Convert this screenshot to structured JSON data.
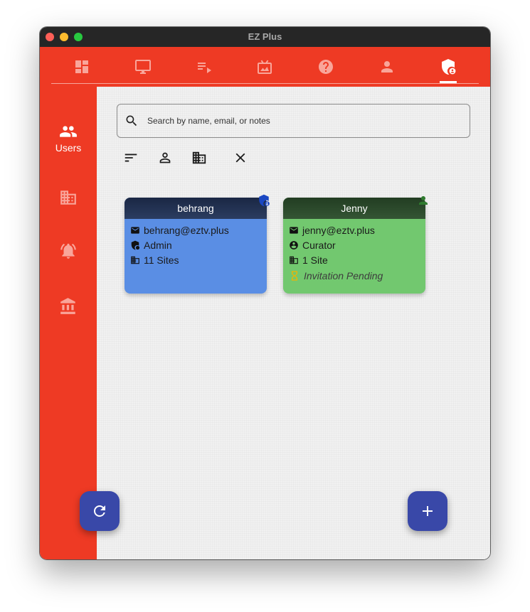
{
  "window": {
    "title": "EZ Plus"
  },
  "top_nav": {
    "tabs": [
      {
        "icon": "dashboard-icon"
      },
      {
        "icon": "monitor-icon"
      },
      {
        "icon": "playlist-icon"
      },
      {
        "icon": "media-icon"
      },
      {
        "icon": "help-icon"
      },
      {
        "icon": "account-icon"
      },
      {
        "icon": "admin-shield-icon",
        "active": true
      }
    ]
  },
  "sidebar": {
    "items": [
      {
        "icon": "users-icon",
        "label": "Users",
        "active": true
      },
      {
        "icon": "building-icon",
        "label": ""
      },
      {
        "icon": "alarm-icon",
        "label": ""
      },
      {
        "icon": "institution-icon",
        "label": ""
      }
    ]
  },
  "search": {
    "placeholder": "Search by name, email, or notes",
    "value": ""
  },
  "filters": [
    "sort-icon",
    "person-filter-icon",
    "building-filter-icon",
    "clear-icon"
  ],
  "users": [
    {
      "name": "behrang",
      "email": "behrang@eztv.plus",
      "role": "Admin",
      "sites": "11 Sites",
      "badge_icon": "admin-shield-icon",
      "header_color": "#1f2d4b",
      "body_color": "#5a8ee4",
      "badge_color": "#1a47c2"
    },
    {
      "name": "Jenny",
      "email": "jenny@eztv.plus",
      "role": "Curator",
      "sites": "1 Site",
      "status": "Invitation Pending",
      "badge_icon": "person-icon",
      "header_color": "#2a4a2a",
      "body_color": "#72c86f",
      "badge_color": "#2f7a2f"
    }
  ],
  "fabs": {
    "refresh_icon": "refresh-icon",
    "add_icon": "add-icon"
  },
  "colors": {
    "brand_red": "#ee3a24",
    "fab_blue": "#3948a8",
    "pending_amber": "#f0b400"
  }
}
